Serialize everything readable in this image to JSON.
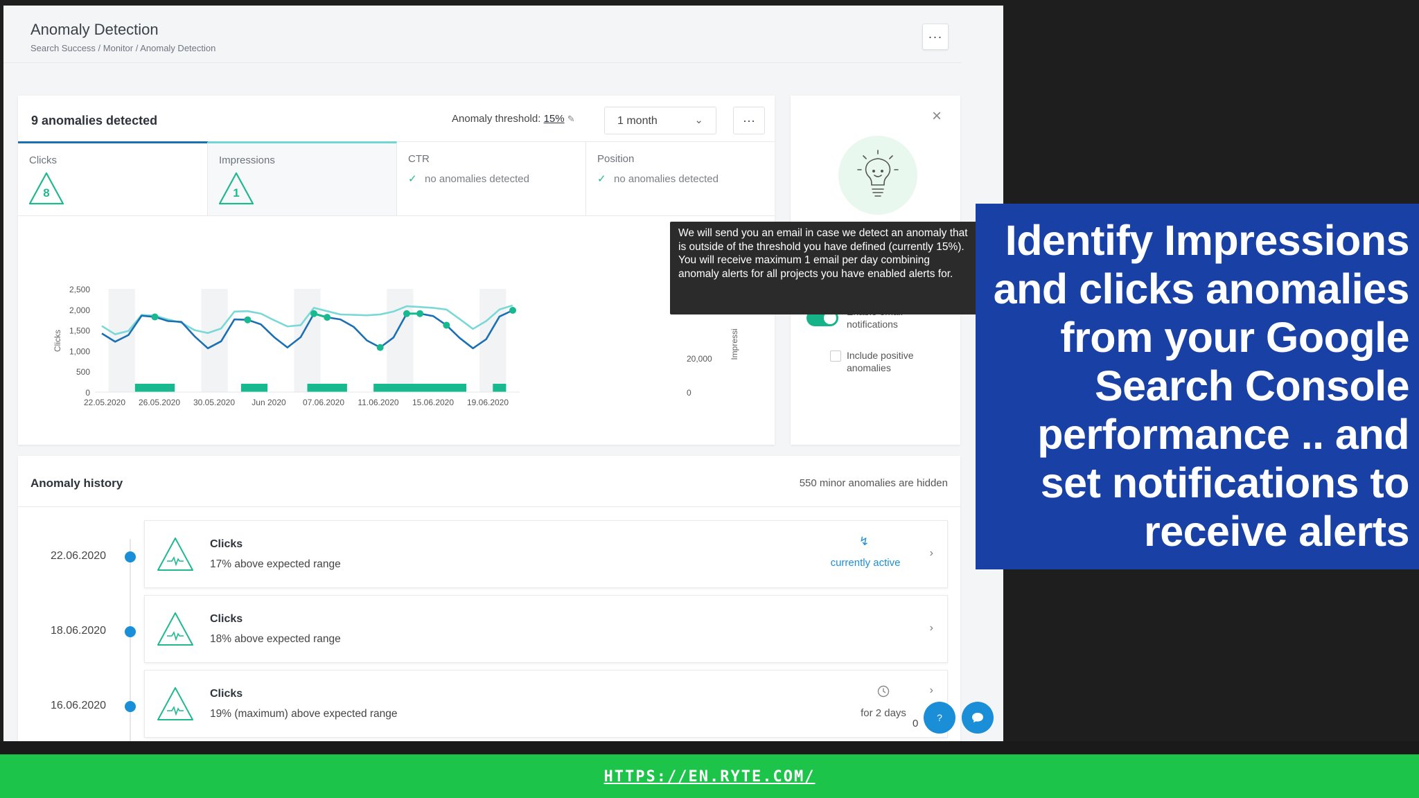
{
  "header": {
    "title": "Anomaly Detection",
    "breadcrumb": "Search Success / Monitor / Anomaly Detection",
    "more_label": "···"
  },
  "anomaly_card": {
    "count_label": "9 anomalies detected",
    "threshold_label": "Anomaly threshold:",
    "threshold_value": "15%",
    "period": "1 month",
    "more_label": "···",
    "tabs": [
      {
        "label": "Clicks",
        "count": "8"
      },
      {
        "label": "Impressions",
        "count": "1"
      },
      {
        "label": "CTR",
        "status": "no anomalies detected"
      },
      {
        "label": "Position",
        "status": "no anomalies detected"
      }
    ]
  },
  "chart_data": {
    "type": "line",
    "ylabel": "Clicks",
    "ylabel_right": "Impressi",
    "yticks": [
      "2,500",
      "2,000",
      "1,500",
      "1,000",
      "500",
      "0"
    ],
    "yticks_right": [
      "20,000",
      "0"
    ],
    "ylim": [
      0,
      2500
    ],
    "xticks": [
      "22.05.2020",
      "26.05.2020",
      "30.05.2020",
      "Jun 2020",
      "07.06.2020",
      "11.06.2020",
      "15.06.2020",
      "19.06.2020"
    ],
    "x": [
      "22.05",
      "23.05",
      "24.05",
      "25.05",
      "26.05",
      "27.05",
      "28.05",
      "29.05",
      "30.05",
      "31.05",
      "01.06",
      "02.06",
      "03.06",
      "04.06",
      "05.06",
      "06.06",
      "07.06",
      "08.06",
      "09.06",
      "10.06",
      "11.06",
      "12.06",
      "13.06",
      "14.06",
      "15.06",
      "16.06",
      "17.06",
      "18.06",
      "19.06",
      "20.06",
      "21.06",
      "22.06"
    ],
    "series": [
      {
        "name": "Clicks",
        "color": "#1b6fb3",
        "values": [
          1420,
          1220,
          1380,
          1850,
          1820,
          1720,
          1700,
          1350,
          1060,
          1230,
          1760,
          1750,
          1640,
          1330,
          1080,
          1330,
          1900,
          1810,
          1760,
          1580,
          1250,
          1080,
          1320,
          1900,
          1900,
          1840,
          1620,
          1310,
          1060,
          1280,
          1830,
          1980
        ]
      },
      {
        "name": "Impressions",
        "color": "#7ad8d6",
        "values": [
          1600,
          1400,
          1480,
          1870,
          1850,
          1760,
          1680,
          1500,
          1430,
          1540,
          1950,
          1960,
          1900,
          1740,
          1590,
          1620,
          2040,
          1960,
          1880,
          1870,
          1860,
          1880,
          1950,
          2080,
          2060,
          2040,
          2000,
          1770,
          1530,
          1720,
          2000,
          2100
        ]
      }
    ],
    "anomaly_points": [
      4,
      11,
      16,
      17,
      21,
      23,
      24,
      26,
      31
    ],
    "weekend_bands": [
      [
        1,
        2
      ],
      [
        8,
        9
      ],
      [
        15,
        16
      ],
      [
        22,
        23
      ],
      [
        29,
        30
      ]
    ],
    "anomaly_bars": [
      [
        3,
        5
      ],
      [
        11,
        12
      ],
      [
        16,
        18
      ],
      [
        21,
        27
      ],
      [
        30,
        30
      ]
    ],
    "colors": {
      "anomaly": "#18b98f",
      "weekend": "#f1f3f5"
    }
  },
  "settings_panel": {
    "email_label": "Enable email notifications",
    "positive_label": "Include positive anomalies"
  },
  "tooltip": {
    "line1": "We will send you an email in case we detect an anomaly that is outside of the threshold you have defined (currently 15%).",
    "line2": "You will receive maximum 1 email per day combining anomaly alerts for all projects you have enabled alerts for."
  },
  "history": {
    "title": "Anomaly history",
    "hidden_label": "550 minor anomalies are hidden",
    "rows": [
      {
        "date": "22.06.2020",
        "metric": "Clicks",
        "desc": "17% above expected range",
        "status": "currently active"
      },
      {
        "date": "18.06.2020",
        "metric": "Clicks",
        "desc": "18% above expected range",
        "status": ""
      },
      {
        "date": "16.06.2020",
        "metric": "Clicks",
        "desc": "19% (maximum) above expected range",
        "status": "for 2 days"
      }
    ]
  },
  "fab": {
    "help_label": "?",
    "chat_count": "0"
  },
  "overlay": {
    "lines": [
      "Identify Impressions",
      "and clicks anomalies",
      "from your Google",
      "Search Console",
      "performance .. and",
      "set notifications to",
      "receive alerts"
    ]
  },
  "footer": {
    "link": "HTTPS://EN.RYTE.COM/"
  }
}
